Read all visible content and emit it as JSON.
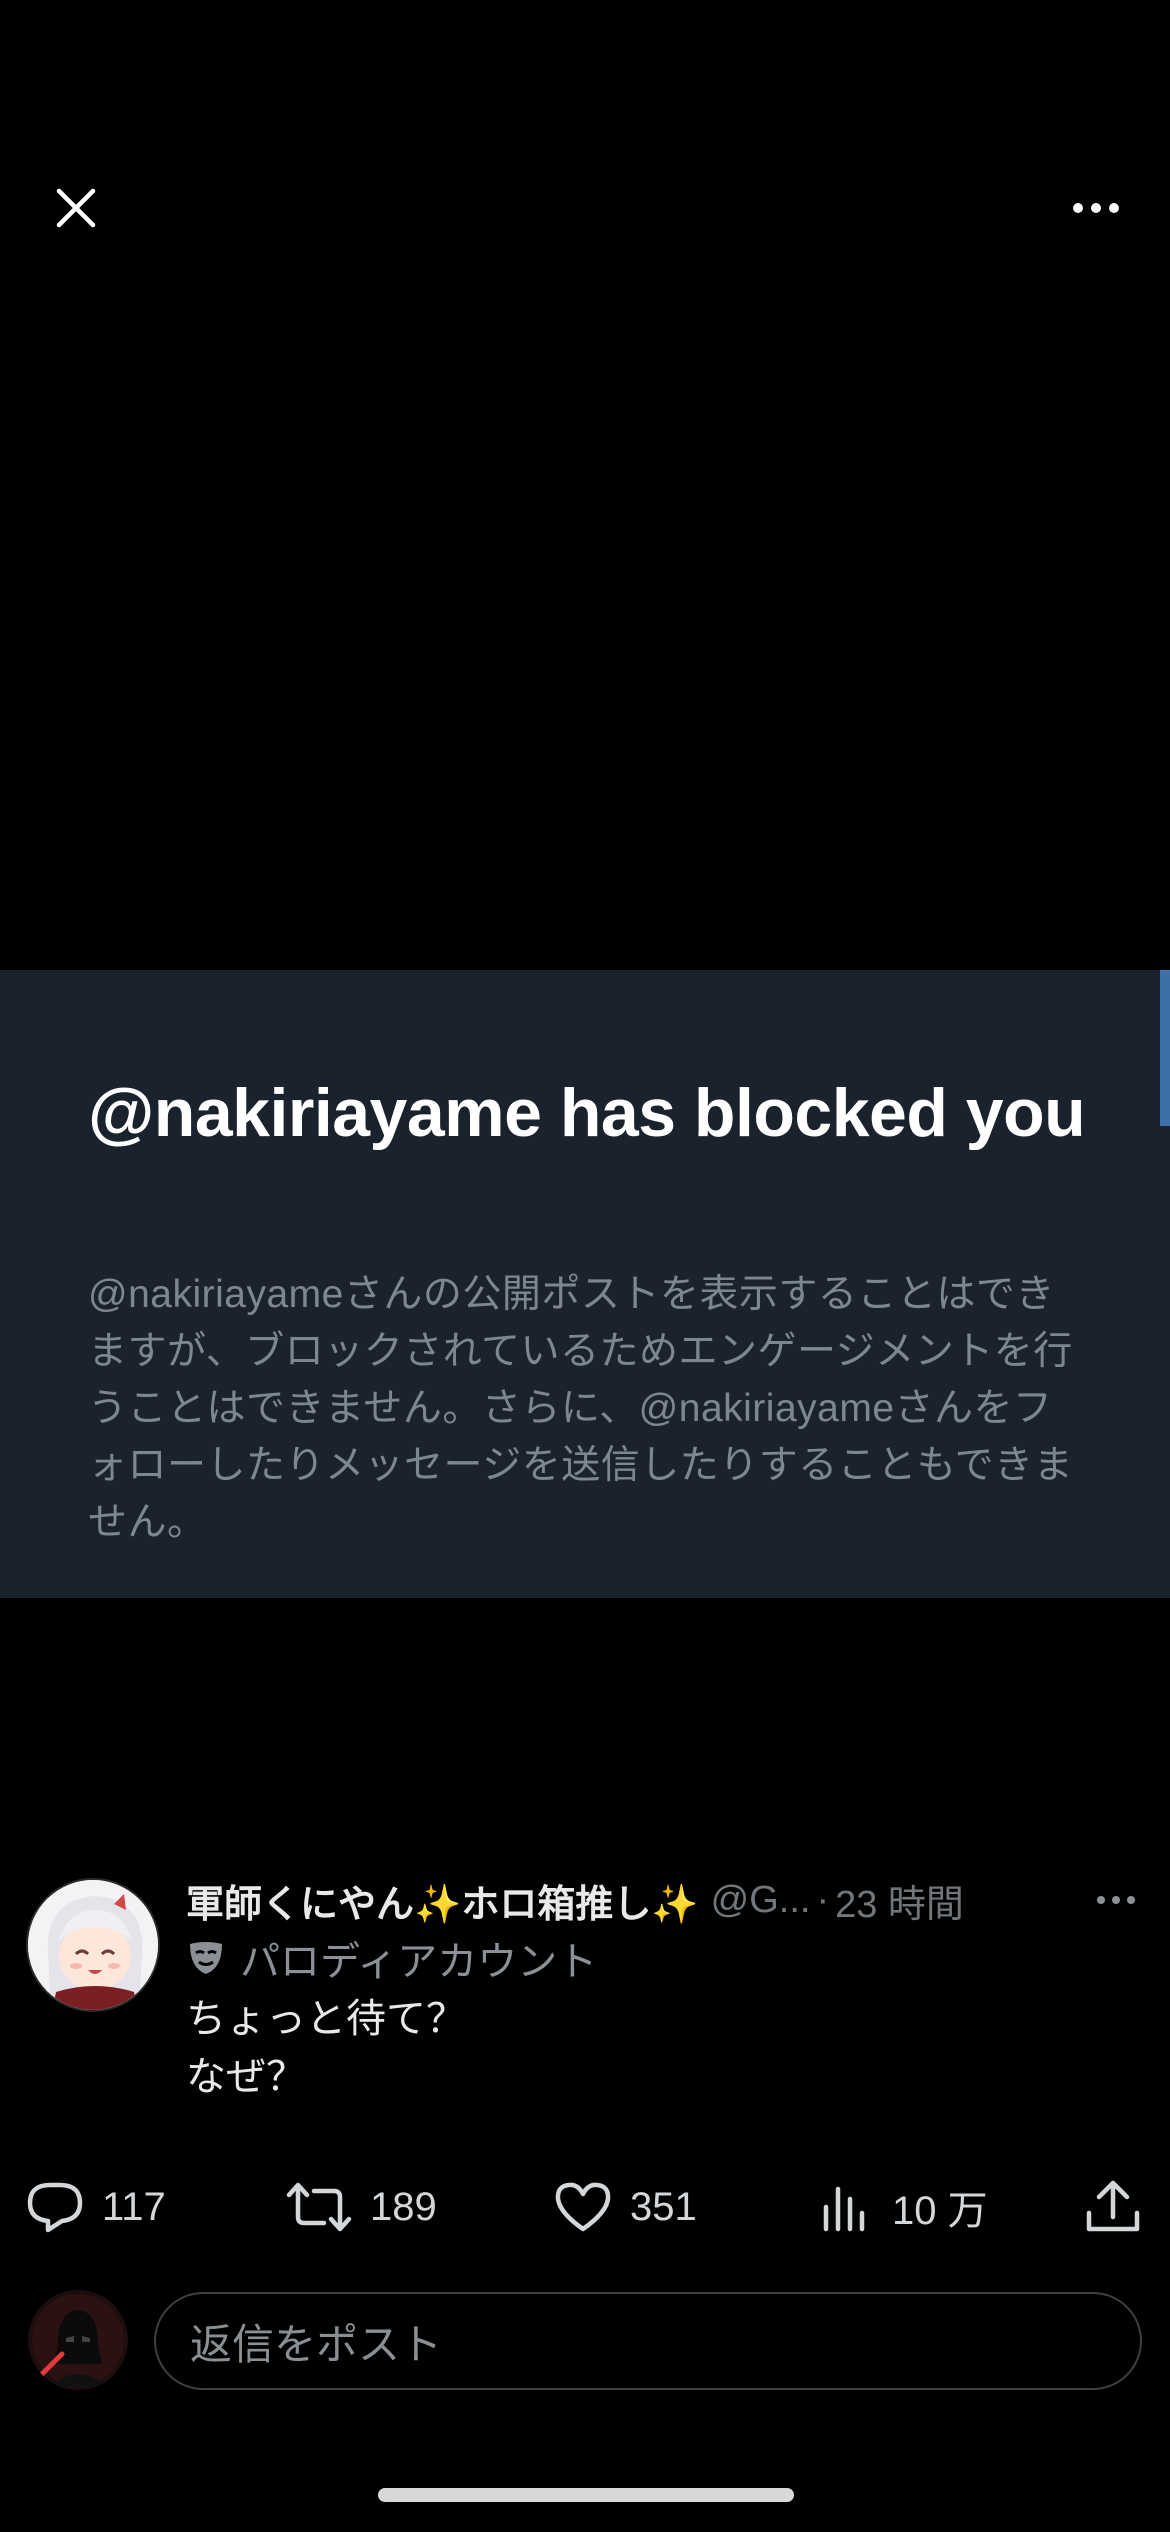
{
  "top_bar": {
    "close_icon": "close-icon",
    "more_icon": "more-horizontal-icon"
  },
  "media": {
    "headline": "@nakiriayame has blocked you",
    "body": "@nakiriayameさんの公開ポストを表示することはできますが、ブロックされているためエンゲージメントを行うことはできません。さらに、@nakiriayameさんをフォローしたりメッセージを送信したりすることもできません。"
  },
  "post": {
    "display_name": "軍師くにやん✨ホロ箱推し✨",
    "handle": "@G...",
    "separator": "·",
    "time": "23 時間",
    "label_icon": "mask-icon",
    "label": "パロディアカウント",
    "text_line1": "ちょっと待て？",
    "text_line2": "なぜ？",
    "more_icon": "more-horizontal-icon"
  },
  "actions": {
    "replies": "117",
    "reposts": "189",
    "likes": "351",
    "views": "10 万"
  },
  "reply": {
    "placeholder": "返信をポスト"
  },
  "colors": {
    "background": "#000000",
    "media_bg": "#1a222e",
    "accent": "#3d6fa8",
    "muted": "#71767b"
  }
}
